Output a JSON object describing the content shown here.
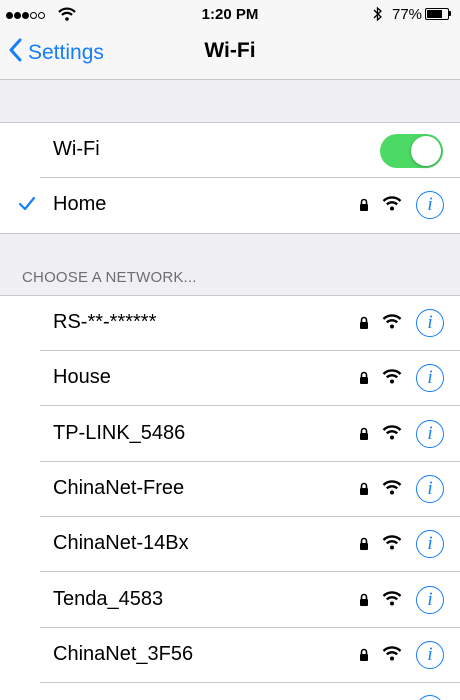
{
  "status_bar": {
    "signal_filled": 3,
    "signal_total": 5,
    "time": "1:20 PM",
    "battery_percent": "77%",
    "battery_level": 0.77,
    "icons": [
      "wifi-signal-icon",
      "bluetooth-icon",
      "battery-icon"
    ]
  },
  "nav": {
    "back_label": "Settings",
    "title": "Wi-Fi"
  },
  "wifi_toggle": {
    "label": "Wi-Fi",
    "on": true
  },
  "connected": {
    "name": "Home",
    "secured": true
  },
  "section_header": "CHOOSE A NETWORK...",
  "networks": [
    {
      "name": "RS-**-******",
      "secured": true
    },
    {
      "name": "House",
      "secured": true
    },
    {
      "name": "TP-LINK_5486",
      "secured": true
    },
    {
      "name": "ChinaNet-Free",
      "secured": true
    },
    {
      "name": "ChinaNet-14Bx",
      "secured": true
    },
    {
      "name": "Tenda_4583",
      "secured": true
    },
    {
      "name": "ChinaNet_3F56",
      "secured": true
    }
  ],
  "colors": {
    "accent": "#147efb",
    "toggle_on": "#4cd964",
    "group_background": "#efeff4",
    "separator": "#c8c7cc"
  }
}
